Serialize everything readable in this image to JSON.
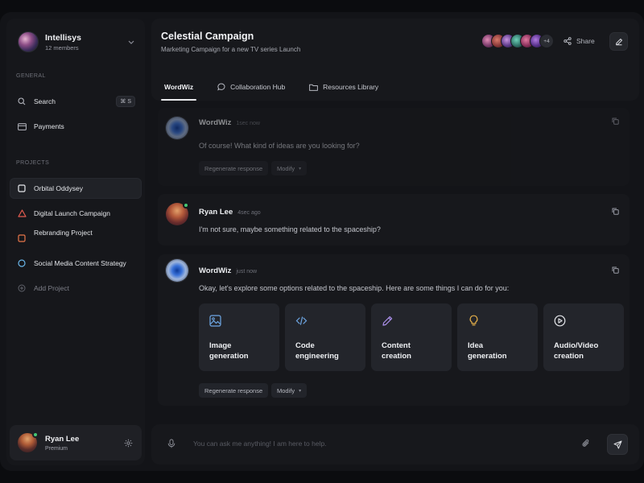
{
  "sidebar": {
    "workspace": {
      "name": "Intellisys",
      "members": "12 members"
    },
    "general_title": "GENERAL",
    "search": {
      "label": "Search",
      "shortcut": "⌘ S"
    },
    "payments": {
      "label": "Payments"
    },
    "projects_title": "PROJECTS",
    "projects": [
      {
        "label": "Orbital Oddysey",
        "color": "#e6e8ec",
        "active": true
      },
      {
        "label": "Digital Launch Campaign",
        "color": "#e25b4f"
      },
      {
        "label": "Rebranding Project",
        "color": "#e8764a"
      },
      {
        "label": "Social Media Content Strategy",
        "color": "#69b5e8"
      }
    ],
    "add_project": "Add Project",
    "user": {
      "name": "Ryan Lee",
      "plan": "Premium"
    }
  },
  "header": {
    "title": "Celestial Campaign",
    "subtitle": "Marketing Campaign for a new TV series Launch",
    "avatars_more": "+4",
    "share_label": "Share",
    "tabs": [
      {
        "label": "WordWiz",
        "icon": "none",
        "active": true
      },
      {
        "label": "Collaboration Hub",
        "icon": "chat-bubble-icon"
      },
      {
        "label": "Resources Library",
        "icon": "folder-icon"
      }
    ]
  },
  "messages": [
    {
      "author": "WordWiz",
      "time": "1sec now",
      "text": "Of course! What kind of ideas are you looking for?",
      "actions": {
        "regenerate": "Regenerate response",
        "modify": "Modify"
      }
    },
    {
      "author": "Ryan Lee",
      "time": "4sec ago",
      "text": "I'm not sure, maybe something related to the spaceship?"
    },
    {
      "author": "WordWiz",
      "time": "just now",
      "text": "Okay, let's explore some options related to the spaceship. Here are some things I can do for you:",
      "options": [
        {
          "label": "Image\ngeneration",
          "icon": "image-icon",
          "color": "#6fa8e6"
        },
        {
          "label": "Code\nengineering",
          "icon": "code-icon",
          "color": "#6fa8e6"
        },
        {
          "label": "Content\ncreation",
          "icon": "pencil-icon",
          "color": "#a98ee8"
        },
        {
          "label": "Idea\ngeneration",
          "icon": "lightbulb-icon",
          "color": "#e8b24a"
        },
        {
          "label": "Audio/Video\ncreation",
          "icon": "play-icon",
          "color": "#e6e8ec"
        }
      ],
      "actions": {
        "regenerate": "Regenerate response",
        "modify": "Modify"
      }
    }
  ],
  "composer": {
    "placeholder": "You can ask me anything! I am here to help."
  }
}
